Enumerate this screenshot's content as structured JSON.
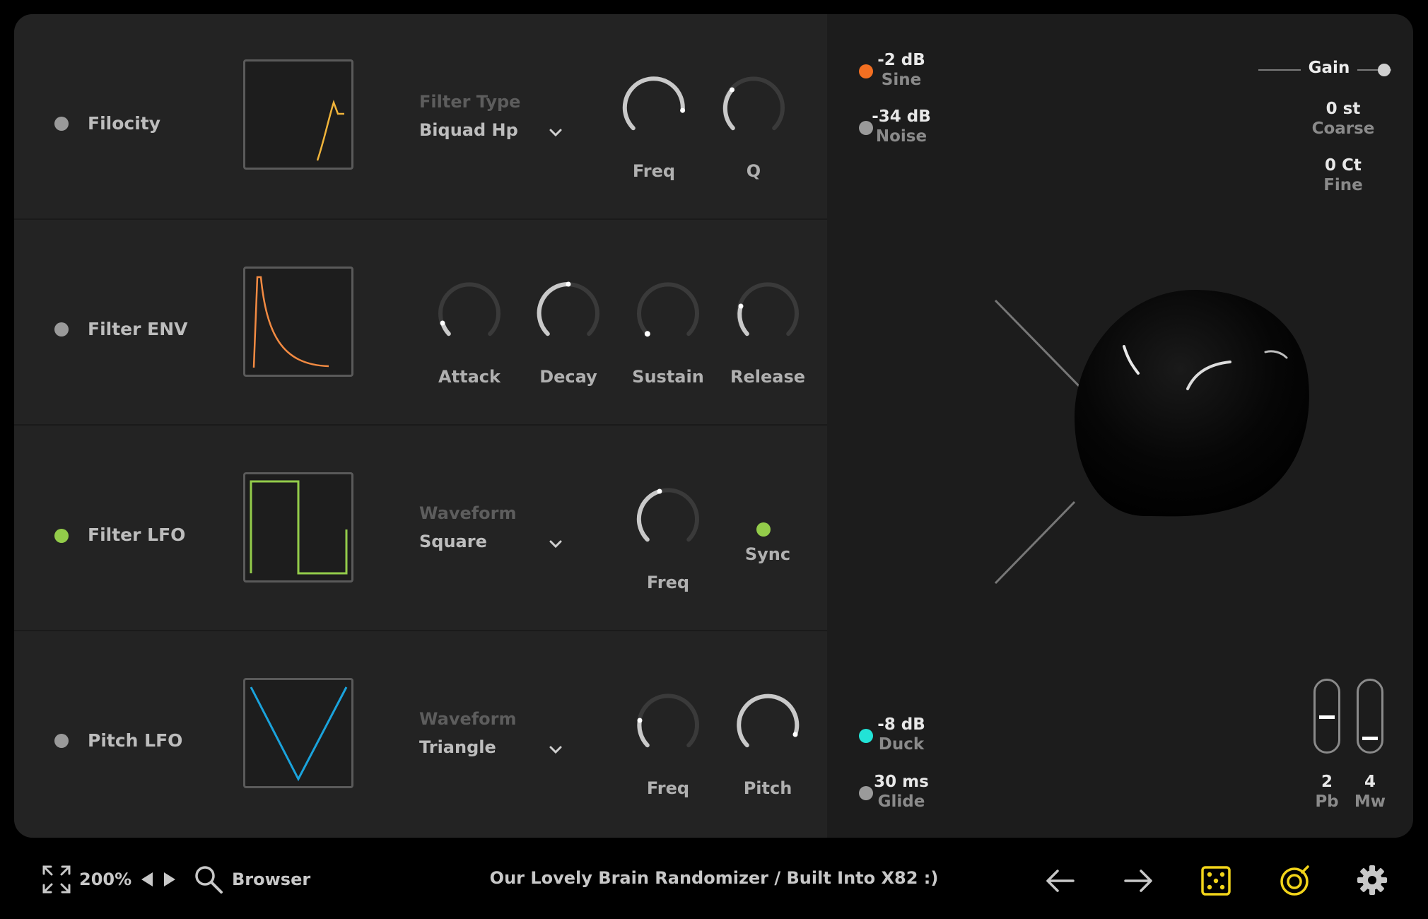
{
  "rows": [
    {
      "label": "Filocity",
      "selector_title": "Filter Type",
      "selector_value": "Biquad Hp",
      "knobs": [
        "Freq",
        "Q"
      ]
    },
    {
      "label": "Filter ENV",
      "knobs": [
        "Attack",
        "Decay",
        "Sustain",
        "Release"
      ]
    },
    {
      "label": "Filter LFO",
      "selector_title": "Waveform",
      "selector_value": "Square",
      "knobs": [
        "Freq"
      ],
      "sync_label": "Sync"
    },
    {
      "label": "Pitch LFO",
      "selector_title": "Waveform",
      "selector_value": "Triangle",
      "knobs": [
        "Freq",
        "Pitch"
      ]
    }
  ],
  "sources": [
    {
      "value": "-2 dB",
      "name": "Sine",
      "color": "#f36f21"
    },
    {
      "value": "-34 dB",
      "name": "Noise",
      "color": "#9a9a9a"
    }
  ],
  "gain": {
    "label": "Gain"
  },
  "tune": [
    {
      "value": "0 st",
      "name": "Coarse"
    },
    {
      "value": "0 Ct",
      "name": "Fine"
    }
  ],
  "duck": {
    "value": "-8 dB",
    "name": "Duck",
    "color": "#22e3d6"
  },
  "glide": {
    "value": "30 ms",
    "name": "Glide"
  },
  "wheels": [
    {
      "value": "2",
      "name": "Pb"
    },
    {
      "value": "4",
      "name": "Mw"
    }
  ],
  "bottom": {
    "zoom": "200%",
    "browser": "Browser",
    "preset": "Our Lovely Brain Randomizer / Built Into X82 :)"
  },
  "colors": {
    "accent_yellow": "#f2d41a",
    "env_orange": "#f28a42",
    "lfo_green": "#93cc4a",
    "pitch_blue": "#1aa3dc",
    "filter_yellow": "#f0b43a"
  }
}
